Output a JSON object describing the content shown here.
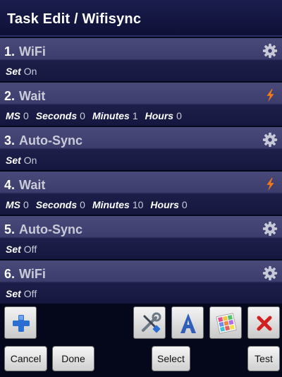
{
  "header": {
    "title": "Task Edit / Wifisync"
  },
  "actions": [
    {
      "num": "1.",
      "name": "WiFi",
      "icon": "gear-icon",
      "params": [
        {
          "key": "Set",
          "value": "On"
        }
      ]
    },
    {
      "num": "2.",
      "name": "Wait",
      "icon": "lightning-icon",
      "params": [
        {
          "key": "MS",
          "value": "0"
        },
        {
          "key": "Seconds",
          "value": "0"
        },
        {
          "key": "Minutes",
          "value": "1"
        },
        {
          "key": "Hours",
          "value": "0"
        }
      ]
    },
    {
      "num": "3.",
      "name": "Auto-Sync",
      "icon": "gear-icon",
      "params": [
        {
          "key": "Set",
          "value": "On"
        }
      ]
    },
    {
      "num": "4.",
      "name": "Wait",
      "icon": "lightning-icon",
      "params": [
        {
          "key": "MS",
          "value": "0"
        },
        {
          "key": "Seconds",
          "value": "0"
        },
        {
          "key": "Minutes",
          "value": "10"
        },
        {
          "key": "Hours",
          "value": "0"
        }
      ]
    },
    {
      "num": "5.",
      "name": "Auto-Sync",
      "icon": "gear-icon",
      "params": [
        {
          "key": "Set",
          "value": "Off"
        }
      ]
    },
    {
      "num": "6.",
      "name": "WiFi",
      "icon": "gear-icon",
      "params": [
        {
          "key": "Set",
          "value": "Off"
        }
      ]
    }
  ],
  "toolbar": {
    "icons": [
      "plus-icon",
      "wrench-screwdriver-icon",
      "letter-a-icon",
      "color-grid-icon",
      "red-x-icon"
    ]
  },
  "buttons": {
    "cancel": "Cancel",
    "done": "Done",
    "select": "Select",
    "test": "Test"
  },
  "colors": {
    "header_bg": "#0e1036",
    "row_top": "#4a4a7a",
    "row_bottom": "#15173f",
    "value_text": "#c9cbd8",
    "wait_icon": "#f07a1a",
    "delete_icon": "#d21f1f",
    "add_icon": "#2a6fd1"
  }
}
